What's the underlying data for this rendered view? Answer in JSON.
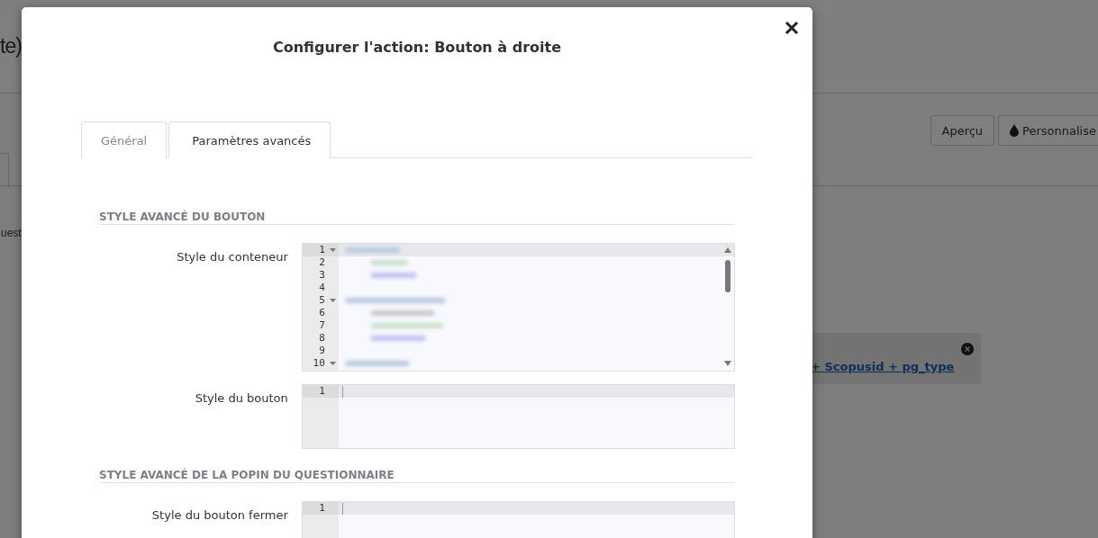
{
  "background": {
    "title": "te)",
    "text": "uest",
    "buttons": [
      {
        "label": "Aperçu",
        "kind": "plain"
      },
      {
        "label": "Personnalise",
        "kind": "drop"
      }
    ],
    "notice": {
      "link": "+ Scopusid + pg_type"
    }
  },
  "dialog": {
    "title": "Configurer l'action: Bouton à droite",
    "tabs": [
      {
        "label": "Général",
        "selected": false
      },
      {
        "label": "Paramètres avancés",
        "selected": true
      }
    ],
    "sections": [
      {
        "heading": "STYLE AVANCÉ DU BOUTON",
        "fields": [
          {
            "label": "Style du conteneur",
            "scrollbar": true,
            "blurred_code": true,
            "lines": [
              {
                "number": "1",
                "foldable": true,
                "active": true
              },
              {
                "number": "2",
                "foldable": false,
                "active": false
              },
              {
                "number": "3",
                "foldable": false,
                "active": false
              },
              {
                "number": "4",
                "foldable": false,
                "active": false
              },
              {
                "number": "5",
                "foldable": true,
                "active": false
              },
              {
                "number": "6",
                "foldable": false,
                "active": false
              },
              {
                "number": "7",
                "foldable": false,
                "active": false
              },
              {
                "number": "8",
                "foldable": false,
                "active": false
              },
              {
                "number": "9",
                "foldable": false,
                "active": false
              },
              {
                "number": "10",
                "foldable": true,
                "active": false
              }
            ]
          },
          {
            "label": "Style du bouton",
            "scrollbar": false,
            "blurred_code": false,
            "lines": [
              {
                "number": "1",
                "foldable": false,
                "active": true
              }
            ]
          }
        ]
      },
      {
        "heading": "STYLE AVANCÉ DE LA POPIN DU QUESTIONNAIRE",
        "fields": [
          {
            "label": "Style du bouton fermer",
            "scrollbar": false,
            "blurred_code": false,
            "lines": [
              {
                "number": "1",
                "foldable": false,
                "active": true
              }
            ]
          }
        ]
      }
    ]
  }
}
